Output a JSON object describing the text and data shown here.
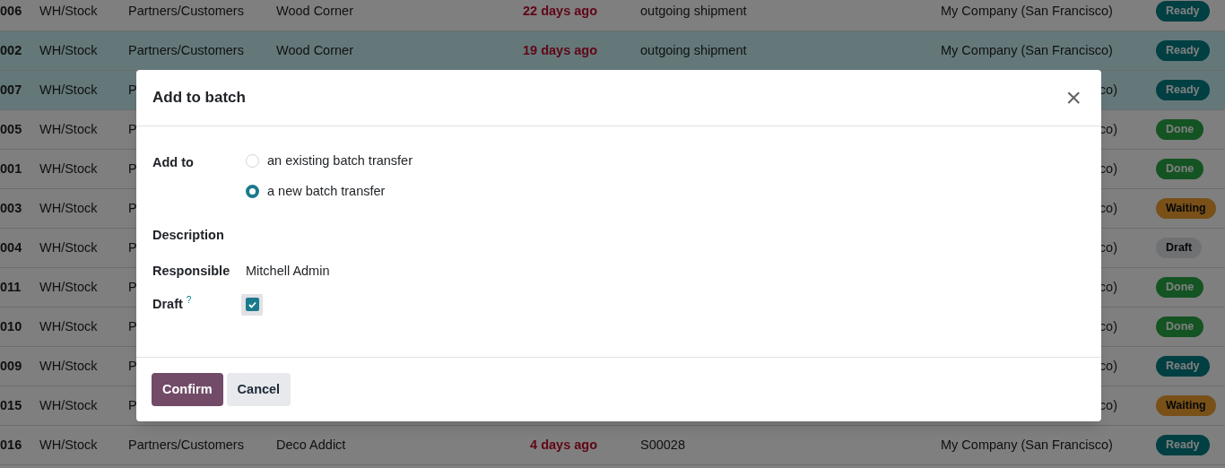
{
  "rows": [
    {
      "ref": "006",
      "source": "WH/Stock",
      "destination": "Partners/Customers",
      "contact": "Wood Corner",
      "scheduled": "22 days ago",
      "operation": "outgoing shipment",
      "company": "My Company (San Francisco)",
      "status": {
        "label": "Ready",
        "kind": "ready"
      },
      "selected": false
    },
    {
      "ref": "002",
      "source": "WH/Stock",
      "destination": "Partners/Customers",
      "contact": "Wood Corner",
      "scheduled": "19 days ago",
      "operation": "outgoing shipment",
      "company": "My Company (San Francisco)",
      "status": {
        "label": "Ready",
        "kind": "ready"
      },
      "selected": true
    },
    {
      "ref": "007",
      "source": "WH/Stock",
      "destination": "P",
      "company": "co)",
      "status": {
        "label": "Ready",
        "kind": "ready"
      },
      "selected": true
    },
    {
      "ref": "005",
      "source": "WH/Stock",
      "destination": "P",
      "company": "co)",
      "status": {
        "label": "Done",
        "kind": "done"
      },
      "selected": false
    },
    {
      "ref": "001",
      "source": "WH/Stock",
      "destination": "P",
      "company": "co)",
      "status": {
        "label": "Done",
        "kind": "done"
      },
      "selected": false
    },
    {
      "ref": "003",
      "source": "WH/Stock",
      "destination": "P",
      "company": "co)",
      "status": {
        "label": "Waiting",
        "kind": "waiting"
      },
      "selected": false
    },
    {
      "ref": "004",
      "source": "WH/Stock",
      "destination": "P",
      "company": "co)",
      "status": {
        "label": "Draft",
        "kind": "draft"
      },
      "selected": false
    },
    {
      "ref": "011",
      "source": "WH/Stock",
      "destination": "P",
      "company": "co)",
      "status": {
        "label": "Done",
        "kind": "done"
      },
      "selected": false
    },
    {
      "ref": "010",
      "source": "WH/Stock",
      "destination": "P",
      "company": "co)",
      "status": {
        "label": "Done",
        "kind": "done"
      },
      "selected": false
    },
    {
      "ref": "009",
      "source": "WH/Stock",
      "destination": "P",
      "company": "co)",
      "status": {
        "label": "Ready",
        "kind": "ready"
      },
      "selected": false
    },
    {
      "ref": "015",
      "source": "WH/Stock",
      "destination": "P",
      "company": "co)",
      "status": {
        "label": "Waiting",
        "kind": "waiting"
      },
      "selected": false
    },
    {
      "ref": "016",
      "source": "WH/Stock",
      "destination": "Partners/Customers",
      "contact": "Deco Addict",
      "scheduled": "4 days ago",
      "operation": "S00028",
      "company": "My Company (San Francisco)",
      "status": {
        "label": "Ready",
        "kind": "ready"
      },
      "selected": false
    }
  ],
  "dialog": {
    "title": "Add to batch",
    "close": "×",
    "add_to": {
      "label": "Add to",
      "options": [
        {
          "label": "an existing batch transfer",
          "selected": false
        },
        {
          "label": "a new batch transfer",
          "selected": true
        }
      ]
    },
    "description": {
      "label": "Description"
    },
    "responsible": {
      "label": "Responsible",
      "value": "Mitchell Admin"
    },
    "draft": {
      "label": "Draft",
      "help": "?",
      "checked": true
    },
    "buttons": [
      {
        "label": "Confirm",
        "kind": "primary"
      },
      {
        "label": "Cancel",
        "kind": "secondary"
      }
    ]
  }
}
